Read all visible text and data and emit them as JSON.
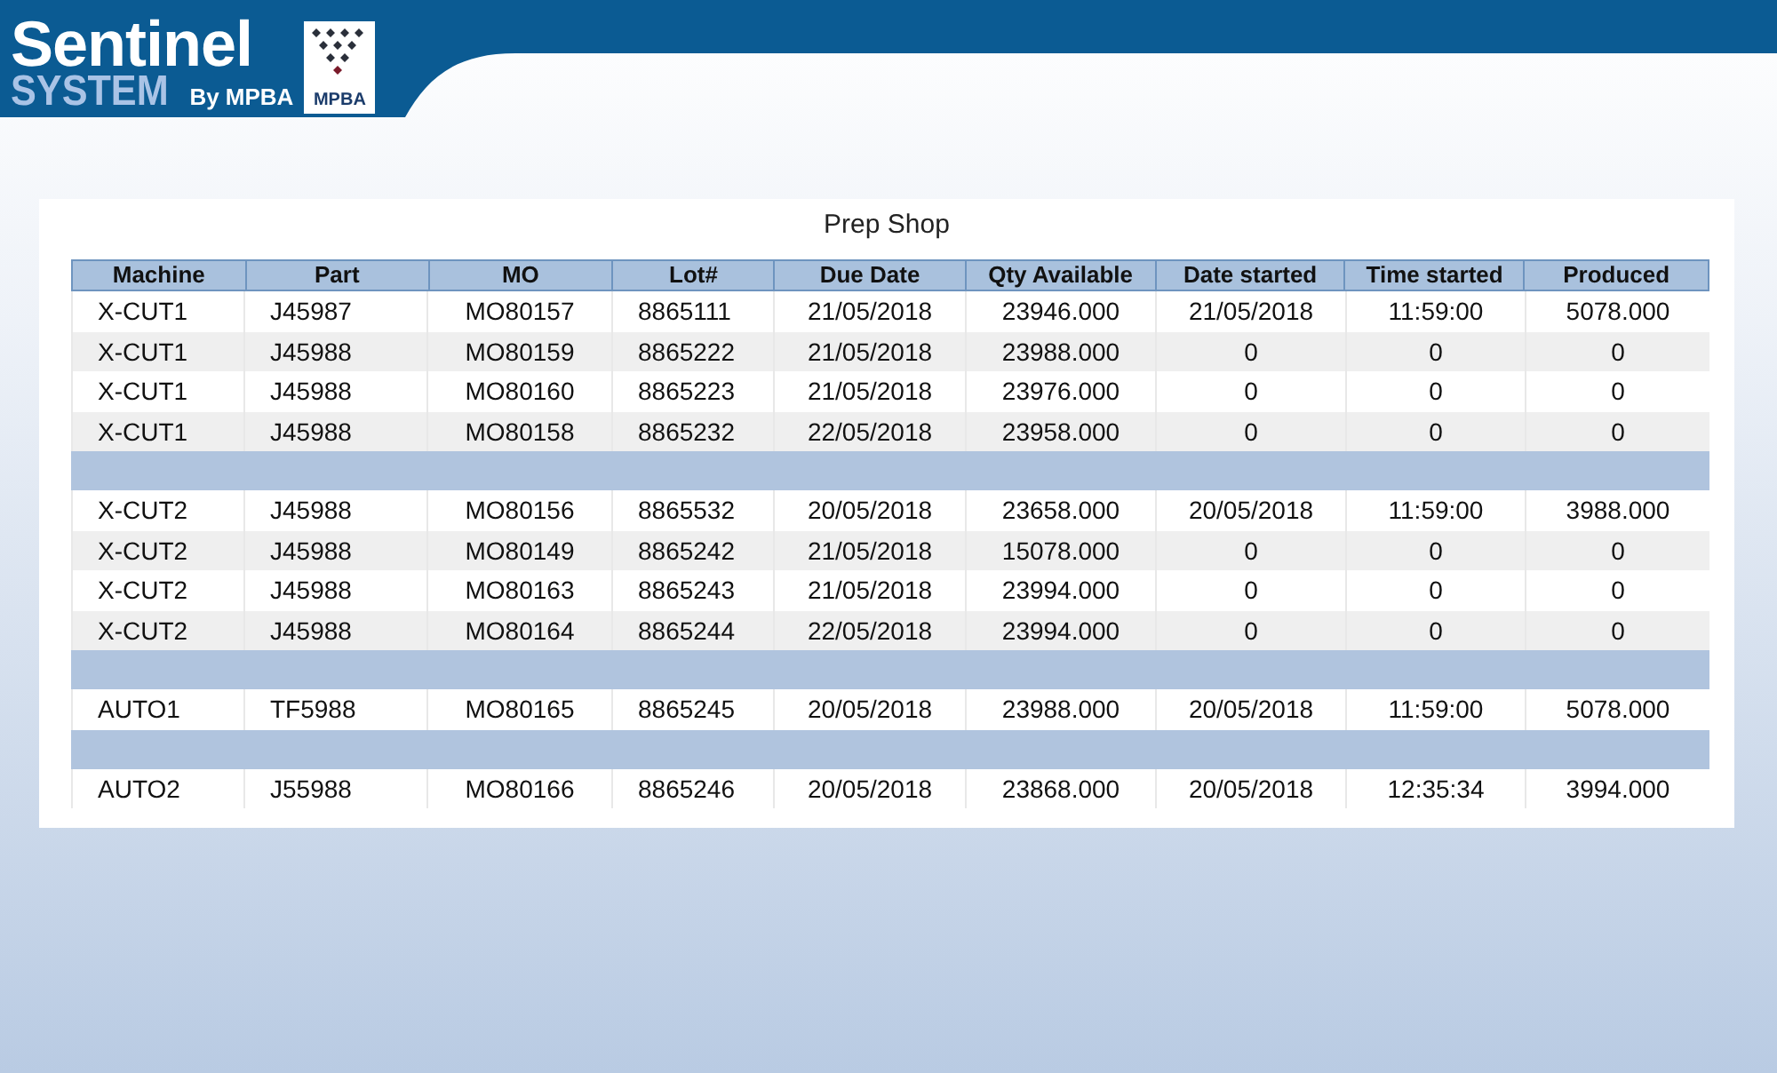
{
  "logo": {
    "name": "Sentinel",
    "sub": "SYSTEM",
    "by": "By MPBA",
    "badge": "MPBA"
  },
  "panel": {
    "title": "Prep Shop",
    "columns": [
      "Machine",
      "Part",
      "MO",
      "Lot#",
      "Due Date",
      "Qty Available",
      "Date started",
      "Time started",
      "Produced"
    ],
    "rows": [
      {
        "kind": "data",
        "cells": [
          "X-CUT1",
          "J45987",
          "MO80157",
          "8865111",
          "21/05/2018",
          "23946.000",
          "21/05/2018",
          "11:59:00",
          "5078.000"
        ]
      },
      {
        "kind": "data",
        "cells": [
          "X-CUT1",
          "J45988",
          "MO80159",
          "8865222",
          "21/05/2018",
          "23988.000",
          "0",
          "0",
          "0"
        ]
      },
      {
        "kind": "data",
        "cells": [
          "X-CUT1",
          "J45988",
          "MO80160",
          "8865223",
          "21/05/2018",
          "23976.000",
          "0",
          "0",
          "0"
        ]
      },
      {
        "kind": "data",
        "cells": [
          "X-CUT1",
          "J45988",
          "MO80158",
          "8865232",
          "22/05/2018",
          "23958.000",
          "0",
          "0",
          "0"
        ]
      },
      {
        "kind": "separator"
      },
      {
        "kind": "data",
        "cells": [
          "X-CUT2",
          "J45988",
          "MO80156",
          "8865532",
          "20/05/2018",
          "23658.000",
          "20/05/2018",
          "11:59:00",
          "3988.000"
        ]
      },
      {
        "kind": "data",
        "cells": [
          "X-CUT2",
          "J45988",
          "MO80149",
          "8865242",
          "21/05/2018",
          "15078.000",
          "0",
          "0",
          "0"
        ]
      },
      {
        "kind": "data",
        "cells": [
          "X-CUT2",
          "J45988",
          "MO80163",
          "8865243",
          "21/05/2018",
          "23994.000",
          "0",
          "0",
          "0"
        ]
      },
      {
        "kind": "data",
        "cells": [
          "X-CUT2",
          "J45988",
          "MO80164",
          "8865244",
          "22/05/2018",
          "23994.000",
          "0",
          "0",
          "0"
        ]
      },
      {
        "kind": "separator"
      },
      {
        "kind": "data",
        "cells": [
          "AUTO1",
          "TF5988",
          "MO80165",
          "8865245",
          "20/05/2018",
          "23988.000",
          "20/05/2018",
          "11:59:00",
          "5078.000"
        ]
      },
      {
        "kind": "separator"
      },
      {
        "kind": "data",
        "cells": [
          "AUTO2",
          "J55988",
          "MO80166",
          "8865246",
          "20/05/2018",
          "23868.000",
          "20/05/2018",
          "12:35:34",
          "3994.000"
        ]
      }
    ]
  }
}
